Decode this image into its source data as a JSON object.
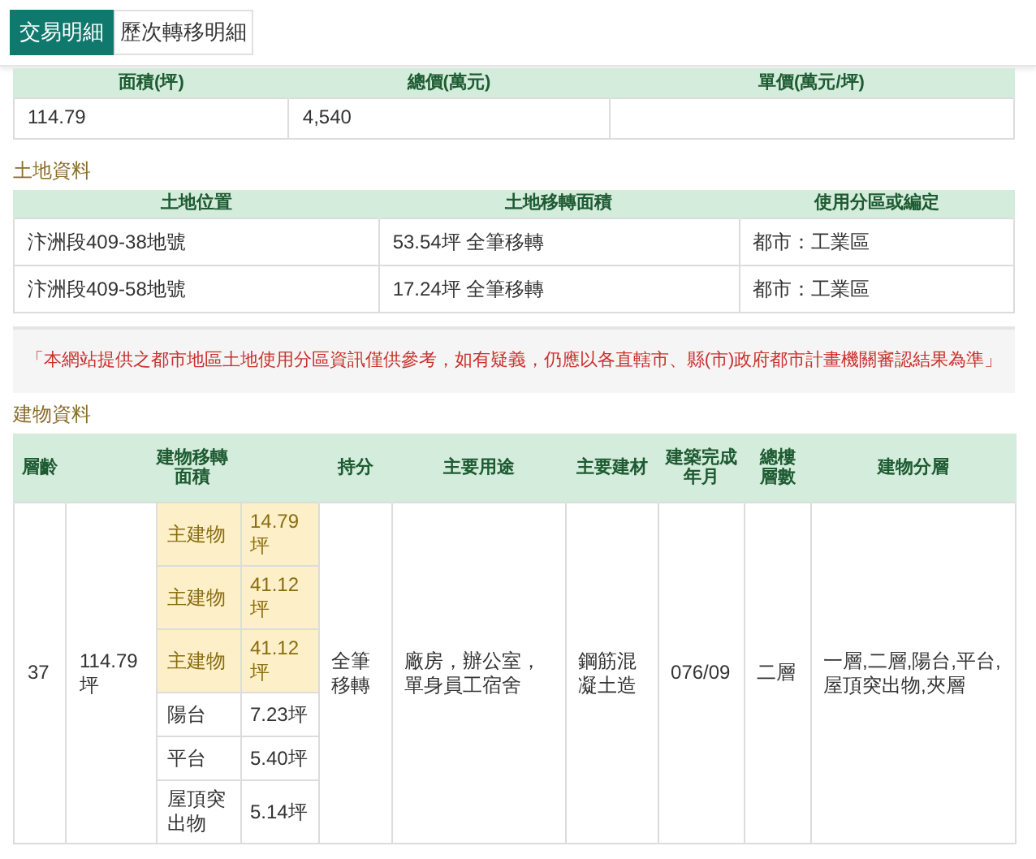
{
  "tabs": [
    {
      "label": "交易明細",
      "selected": true
    },
    {
      "label": "歷次轉移明細",
      "selected": false
    }
  ],
  "summary": {
    "columns": [
      "面積(坪)",
      "總價(萬元)",
      "單價(萬元/坪)"
    ],
    "rows": [
      [
        "114.79",
        "4,540",
        ""
      ]
    ]
  },
  "land_section": {
    "title": "土地資料",
    "columns": [
      "土地位置",
      "土地移轉面積",
      "使用分區或編定"
    ],
    "rows": [
      [
        "汴洲段409-38地號",
        "53.54坪 全筆移轉",
        "都市：工業區"
      ],
      [
        "汴洲段409-58地號",
        "17.24坪 全筆移轉",
        "都市：工業區"
      ]
    ]
  },
  "notice": "「本網站提供之都市地區土地使用分區資訊僅供參考，如有疑義，仍應以各直轄市、縣(市)政府都市計畫機關審認結果為準」",
  "building_section": {
    "title": "建物資料",
    "columns": [
      "層齡",
      "建物移轉面積",
      "持分",
      "主要用途",
      "主要建材",
      "建築完成年月",
      "總樓層數",
      "建物分層"
    ],
    "row": {
      "age": "37",
      "area": "114.79坪",
      "parts": [
        {
          "label": "主建物",
          "value": "14.79坪",
          "highlighted": true
        },
        {
          "label": "主建物",
          "value": "41.12坪",
          "highlighted": true
        },
        {
          "label": "主建物",
          "value": "41.12坪",
          "highlighted": true
        },
        {
          "label": "陽台",
          "value": "7.23坪",
          "highlighted": false
        },
        {
          "label": "平台",
          "value": "5.40坪",
          "highlighted": false
        },
        {
          "label": "屋頂突出物",
          "value": "5.14坪",
          "highlighted": false
        }
      ],
      "share": "全筆移轉",
      "use": "廠房，辦公室，單身員工宿舍",
      "material": "鋼筋混凝土造",
      "completed": "076/09",
      "floors": "二層",
      "layers": "一層,二層,陽台,平台,屋頂突出物,夾層"
    }
  }
}
